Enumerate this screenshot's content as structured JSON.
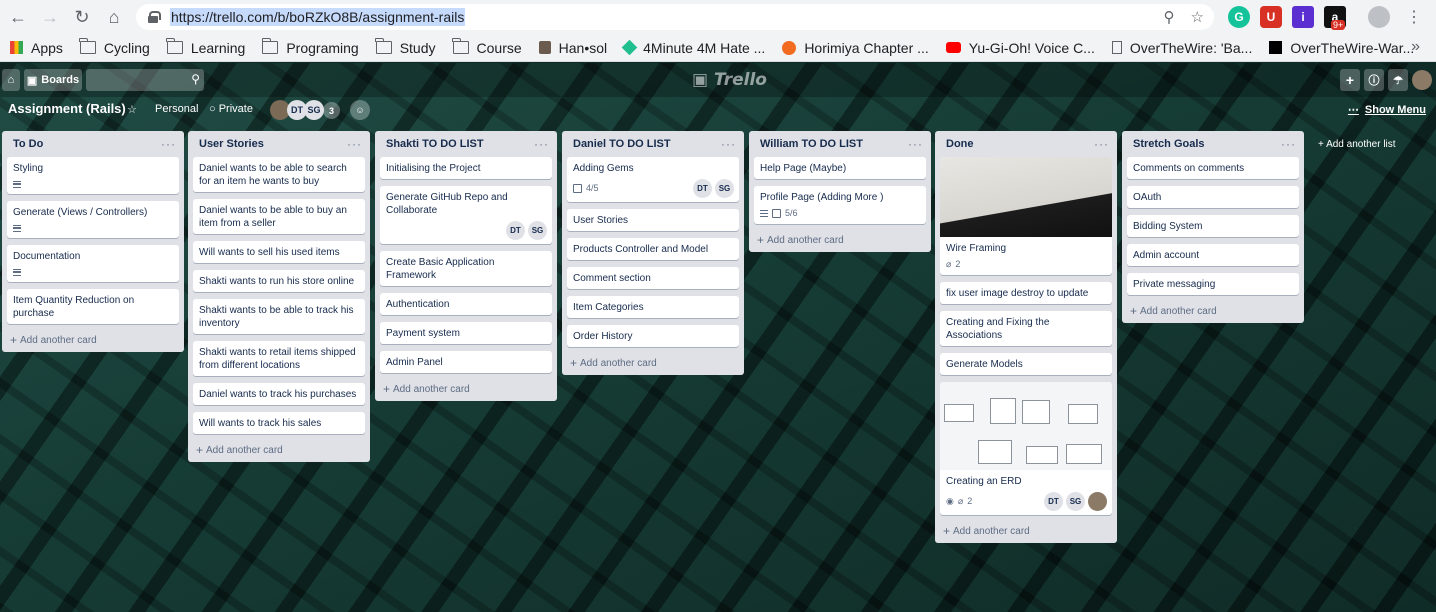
{
  "browser": {
    "url": "https://trello.com/b/boRZkO8B/assignment-rails",
    "bookmarks": [
      "Apps",
      "Cycling",
      "Learning",
      "Programing",
      "Study",
      "Course",
      "Han•sol",
      "4Minute 4M Hate ...",
      "Horimiya Chapter ...",
      "Yu-Gi-Oh! Voice C...",
      "OverTheWire: 'Ba...",
      "OverTheWire-War..."
    ],
    "more": "»",
    "ext_badge": "9+"
  },
  "trello": {
    "boards_label": "Boards",
    "logo": "Trello",
    "board_title": "Assignment (Rails)",
    "team": "Personal",
    "visibility": "Private",
    "member_initials": [
      "DT",
      "SG"
    ],
    "member_more": "3",
    "show_menu": "Show Menu",
    "add_list": "+ Add another list",
    "add_card": "Add another card"
  },
  "lists": [
    {
      "title": "To Do",
      "cards": [
        {
          "text": "Styling",
          "desc": true
        },
        {
          "text": "Generate (Views / Controllers)",
          "desc": true
        },
        {
          "text": "Documentation",
          "desc": true
        },
        {
          "text": "Item Quantity Reduction on purchase"
        }
      ]
    },
    {
      "title": "User Stories",
      "cards": [
        {
          "text": "Daniel wants to be able to search for an item he wants to buy"
        },
        {
          "text": "Daniel wants to be able to buy an item from a seller"
        },
        {
          "text": "Will wants to sell his used items"
        },
        {
          "text": "Shakti wants to run his store online"
        },
        {
          "text": "Shakti wants to be able to track his inventory"
        },
        {
          "text": "Shakti wants to retail items shipped from different locations"
        },
        {
          "text": "Daniel wants to track his purchases"
        },
        {
          "text": "Will wants to track his sales"
        }
      ]
    },
    {
      "title": "Shakti TO DO LIST",
      "cards": [
        {
          "text": "Initialising the Project"
        },
        {
          "text": "Generate GitHub Repo and Collaborate",
          "members": [
            "DT",
            "SG"
          ]
        },
        {
          "text": "Create Basic Application Framework"
        },
        {
          "text": "Authentication"
        },
        {
          "text": "Payment system"
        },
        {
          "text": "Admin Panel"
        }
      ]
    },
    {
      "title": "Daniel TO DO LIST",
      "cards": [
        {
          "text": "Adding Gems",
          "check": "4/5",
          "members": [
            "DT",
            "SG"
          ]
        },
        {
          "text": "User Stories"
        },
        {
          "text": "Products Controller and Model"
        },
        {
          "text": "Comment section"
        },
        {
          "text": "Item Categories"
        },
        {
          "text": "Order History"
        }
      ]
    },
    {
      "title": "William TO DO LIST",
      "cards": [
        {
          "text": "Help Page (Maybe)"
        },
        {
          "text": "Profile Page (Adding More )",
          "desc": true,
          "check": "5/6"
        }
      ]
    },
    {
      "title": "Done",
      "cards": [
        {
          "text": "Wire Framing",
          "cover": "photo",
          "attach": "2"
        },
        {
          "text": "fix user image destroy to update"
        },
        {
          "text": "Creating and Fixing the Associations"
        },
        {
          "text": "Generate Models"
        },
        {
          "text": "Creating an ERD",
          "cover": "erd",
          "watch": true,
          "attach": "2",
          "members": [
            "DT",
            "SG"
          ],
          "photo_member": true
        }
      ]
    },
    {
      "title": "Stretch Goals",
      "cards": [
        {
          "text": "Comments on comments"
        },
        {
          "text": "OAuth"
        },
        {
          "text": "Bidding System"
        },
        {
          "text": "Admin account"
        },
        {
          "text": "Private messaging"
        }
      ]
    }
  ]
}
